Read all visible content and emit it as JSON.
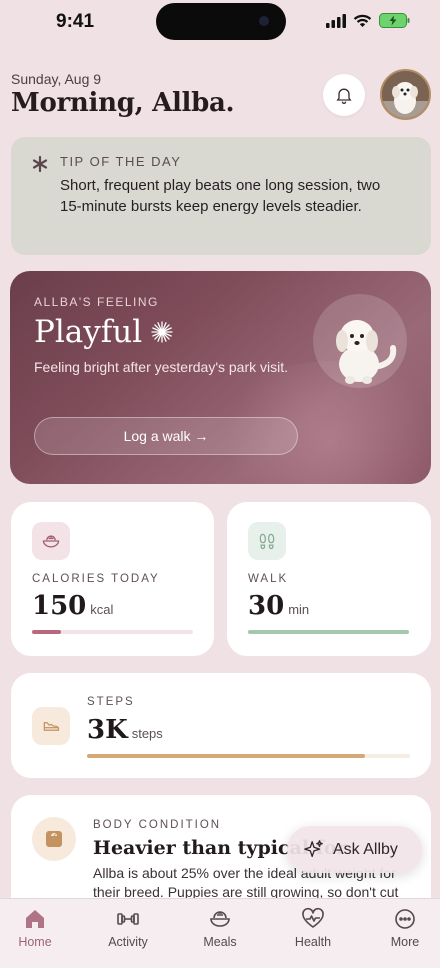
{
  "status_bar": {
    "time": "9:41"
  },
  "header": {
    "date": "Sunday, Aug 9",
    "greeting": "Morning, Allba."
  },
  "tip": {
    "label": "TIP OF THE DAY",
    "text": "Short, frequent play beats one long session, two 15-minute bursts keep energy levels steadier."
  },
  "feeling": {
    "label": "ALLBA'S FEELING",
    "mood": "Playful",
    "description": "Feeling bright after yesterday's park visit.",
    "button": "Log a walk →"
  },
  "stats": {
    "calories": {
      "label": "CALORIES TODAY",
      "value": "150",
      "unit": "kcal",
      "progress": 0.18
    },
    "walk": {
      "label": "WALK",
      "value": "30",
      "unit": "min",
      "progress": 1.0
    },
    "steps": {
      "label": "STEPS",
      "value": "3K",
      "unit": "steps",
      "progress": 0.86
    }
  },
  "body_condition": {
    "label": "BODY CONDITION",
    "title": "Heavier than typical for",
    "text": "Allba is about 25% over the ideal adult weight for their breed. Puppies are still growing, so don't cut"
  },
  "ask_button": "Ask Allby",
  "tabs": [
    {
      "label": "Home",
      "icon": "home-icon",
      "active": true
    },
    {
      "label": "Activity",
      "icon": "dumbbell-icon",
      "active": false
    },
    {
      "label": "Meals",
      "icon": "bowl-icon",
      "active": false
    },
    {
      "label": "Health",
      "icon": "heart-pulse-icon",
      "active": false
    },
    {
      "label": "More",
      "icon": "more-icon",
      "active": false
    }
  ],
  "colors": {
    "background": "#efe1e4",
    "accent": "#a06378",
    "calories_bar": "#b9677e",
    "walk_bar": "#a2c9ad",
    "steps_bar": "#d6a877"
  }
}
